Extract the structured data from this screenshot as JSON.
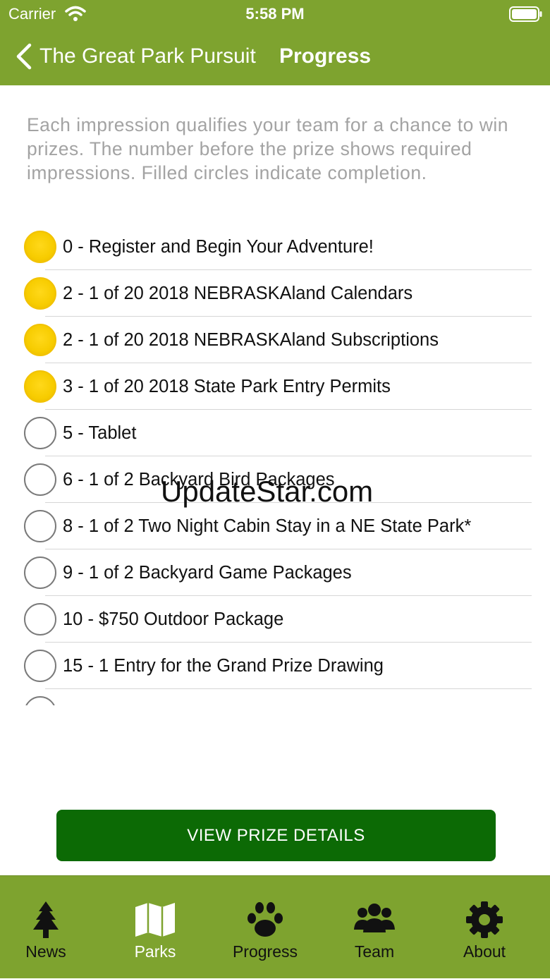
{
  "status_bar": {
    "carrier": "Carrier",
    "time": "5:58 PM"
  },
  "nav": {
    "back_label": "The Great Park Pursuit",
    "title": "Progress"
  },
  "intro_text": "Each impression qualifies your team for a chance to win prizes. The number before the prize shows required impressions. Filled circles indicate completion.",
  "prizes": [
    {
      "label": "0 - Register and Begin Your Adventure!",
      "completed": true
    },
    {
      "label": "2 - 1 of 20 2018 NEBRASKAland Calendars",
      "completed": true
    },
    {
      "label": "2 - 1 of 20 2018 NEBRASKAland Subscriptions",
      "completed": true
    },
    {
      "label": "3 - 1 of 20 2018 State Park Entry Permits",
      "completed": true
    },
    {
      "label": "5 - Tablet",
      "completed": false
    },
    {
      "label": "6 - 1 of 2 Backyard Bird Packages",
      "completed": false
    },
    {
      "label": "8 - 1 of 2 Two Night Cabin Stay in a NE State Park*",
      "completed": false
    },
    {
      "label": "9 - 1 of 2 Backyard Game Packages",
      "completed": false
    },
    {
      "label": "10 - $750 Outdoor Package",
      "completed": false
    },
    {
      "label": "15 - 1 Entry for the Grand Prize Drawing",
      "completed": false
    }
  ],
  "watermark": "UpdateStar.com",
  "button": {
    "label": "VIEW PRIZE DETAILS"
  },
  "tabs": [
    {
      "label": "News",
      "icon": "tree-icon",
      "active": false
    },
    {
      "label": "Parks",
      "icon": "map-icon",
      "active": true
    },
    {
      "label": "Progress",
      "icon": "paw-icon",
      "active": false
    },
    {
      "label": "Team",
      "icon": "people-icon",
      "active": false
    },
    {
      "label": "About",
      "icon": "gear-icon",
      "active": false
    }
  ],
  "colors": {
    "header_green": "#7ea32f",
    "button_green": "#0c6a05",
    "completed_yellow": "#f7cc00",
    "intro_gray": "#a3a3a3"
  }
}
